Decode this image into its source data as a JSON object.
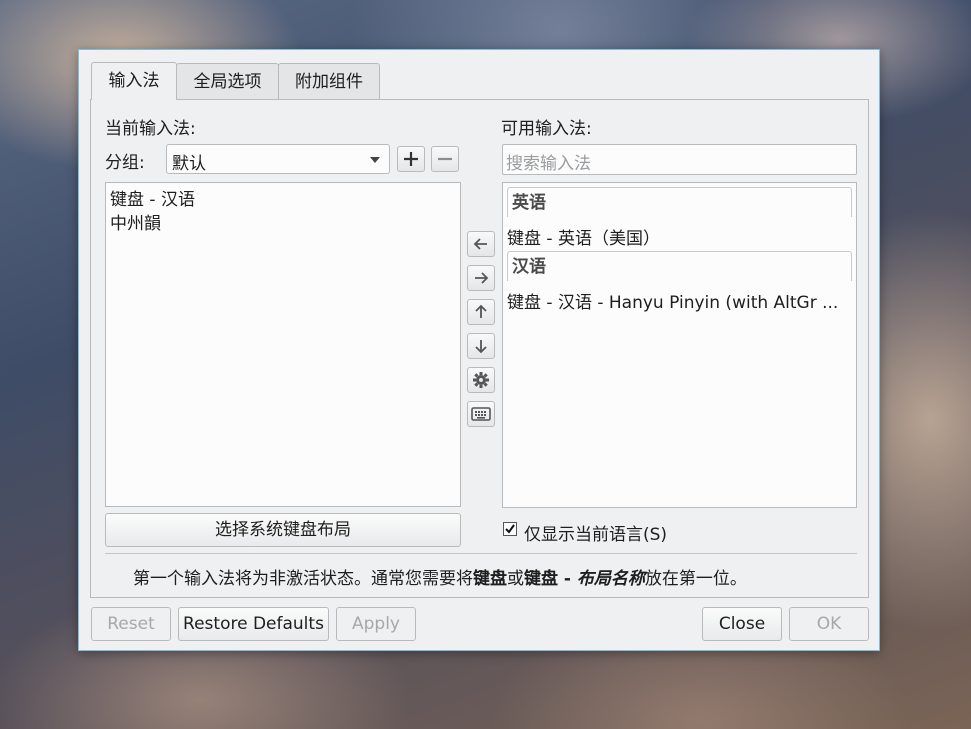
{
  "tabs": [
    {
      "label": "输入法"
    },
    {
      "label": "全局选项"
    },
    {
      "label": "附加组件"
    }
  ],
  "current": {
    "heading": "当前输入法:",
    "group_label": "分组:",
    "group_value": "默认",
    "items": [
      "键盘 - 汉语",
      "中州韻"
    ],
    "select_layout_button": "选择系统键盘布局"
  },
  "available": {
    "heading": "可用输入法:",
    "search_placeholder": "搜索输入法",
    "groups": [
      {
        "name": "英语",
        "items": [
          "键盘 - 英语（美国）"
        ]
      },
      {
        "name": "汉语",
        "items": [
          "键盘 - 汉语 - Hanyu Pinyin (with AltGr ..."
        ]
      }
    ],
    "only_current_language_label": "仅显示当前语言(S)",
    "only_current_language_checked": true
  },
  "hint": {
    "part1": "第一个输入法将为非激活状态。通常您需要将",
    "bold1": "键盘",
    "part2": "或",
    "bold2": "键盘 - ",
    "bold_italic": "布局名称",
    "part3": "放在第一位。"
  },
  "buttons": {
    "reset": "Reset",
    "restore_defaults": "Restore Defaults",
    "apply": "Apply",
    "close": "Close",
    "ok": "OK"
  },
  "icons": {
    "move_left": "arrow-left-icon",
    "move_right": "arrow-right-icon",
    "move_up": "arrow-up-icon",
    "move_down": "arrow-down-icon",
    "configure": "gear-icon",
    "keyboard": "keyboard-icon"
  }
}
